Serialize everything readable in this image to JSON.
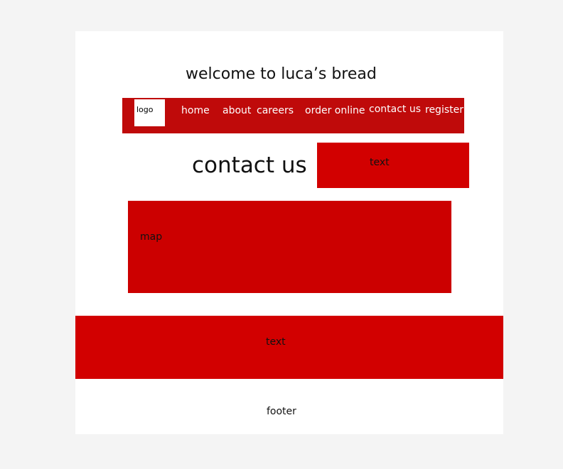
{
  "header": {
    "title": "welcome to luca’s bread"
  },
  "nav": {
    "logo_label": "logo",
    "items": [
      {
        "label": "home"
      },
      {
        "label": "about"
      },
      {
        "label": "careers"
      },
      {
        "label": "order online"
      },
      {
        "label": "contact us"
      },
      {
        "label": "register"
      }
    ]
  },
  "main": {
    "heading": "contact us",
    "side_text": "text",
    "map_label": "map",
    "band_text": "text"
  },
  "footer": {
    "label": "footer"
  },
  "colors": {
    "background": "#f4f4f4",
    "page": "#ffffff",
    "nav_red": "#bf0a0a",
    "box_red": "#d20000"
  }
}
